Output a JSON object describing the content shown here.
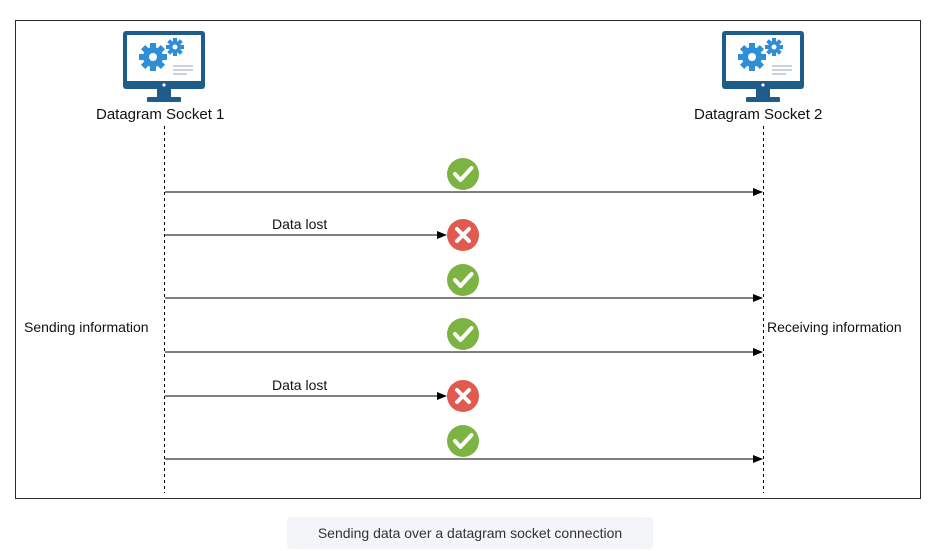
{
  "socket_1": {
    "label": "Datagram Socket 1",
    "icon": "computer-gears-icon"
  },
  "socket_2": {
    "label": "Datagram Socket 2",
    "icon": "computer-gears-icon"
  },
  "side_labels": {
    "left": "Sending information",
    "right": "Receiving information"
  },
  "messages": [
    {
      "status": "delivered",
      "label": ""
    },
    {
      "status": "lost",
      "label": "Data lost"
    },
    {
      "status": "delivered",
      "label": ""
    },
    {
      "status": "delivered",
      "label": ""
    },
    {
      "status": "lost",
      "label": "Data lost"
    },
    {
      "status": "delivered",
      "label": ""
    }
  ],
  "colors": {
    "delivered": "#7cb342",
    "lost": "#e05a4f",
    "monitor": "#1e5c8c",
    "gear": "#2f8ed8"
  },
  "caption": "Sending data over a datagram socket connection"
}
